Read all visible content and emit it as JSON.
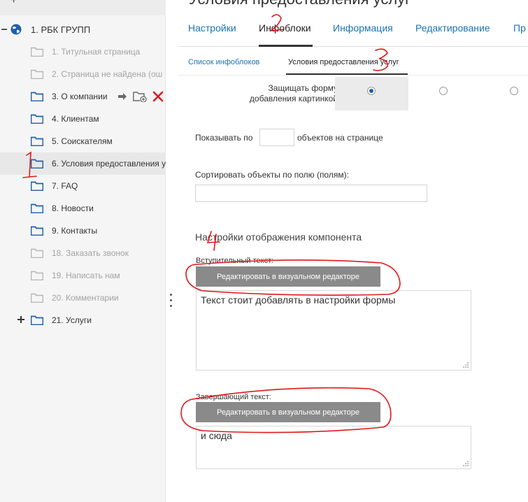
{
  "tree": {
    "root": "1. РБК ГРУПП",
    "items": [
      {
        "label": "1. Титульная страница",
        "dim": true
      },
      {
        "label": "2. Страница не найдена (ош",
        "dim": true
      },
      {
        "label": "3. О компании",
        "dim": false
      },
      {
        "label": "4. Клиентам",
        "dim": false
      },
      {
        "label": "5. Соискателям",
        "dim": false
      },
      {
        "label": "6. Условия предоставления у",
        "dim": false
      },
      {
        "label": "7. FAQ",
        "dim": false
      },
      {
        "label": "8. Новости",
        "dim": false
      },
      {
        "label": "9. Контакты",
        "dim": false
      },
      {
        "label": "18. Заказать звонок",
        "dim": true
      },
      {
        "label": "19. Написать нам",
        "dim": true
      },
      {
        "label": "20. Комментарии",
        "dim": true
      },
      {
        "label": "21. Услуги",
        "dim": false
      }
    ],
    "selected_index": 5,
    "expandable_index": 12
  },
  "header": {
    "title_fragment": "Условия предоставления услуг"
  },
  "tabs": [
    "Настройки",
    "Инфоблоки",
    "Информация",
    "Редактирование",
    "Пр"
  ],
  "active_tab": "Инфоблоки",
  "subtabs": [
    "Список инфоблоков",
    "Условия предоставления услуг"
  ],
  "active_subtab": "Условия предоставления услуг",
  "form": {
    "protect_label_1": "Защищать форму",
    "protect_label_2": "добавления картинкой",
    "radio_selected_index": 0,
    "per_page_before": "Показывать по",
    "per_page_after": "объектов на странице",
    "per_page_value": "",
    "sort_label": "Сортировать объекты по полю (полям):",
    "sort_value": "",
    "display_heading": "Настройки отображения компонента",
    "intro_label": "Вступительный текст:",
    "edit_visual_button": "Редактировать в визуальном редакторе",
    "intro_text": "Текст стоит добавлять в настройки формы",
    "closing_label": "Завершающий текст:",
    "closing_text": "и сюда"
  },
  "annotations": {
    "mark_1": "1",
    "mark_2": "2",
    "mark_3": "3",
    "mark_4": "4",
    "color": "#e0191b"
  },
  "colors": {
    "link": "#1a73b5",
    "button_gray": "#8a8a8a",
    "folder_blue": "#1f5fa9",
    "folder_gray": "#b5b5b5",
    "delete_red": "#e0191b"
  }
}
